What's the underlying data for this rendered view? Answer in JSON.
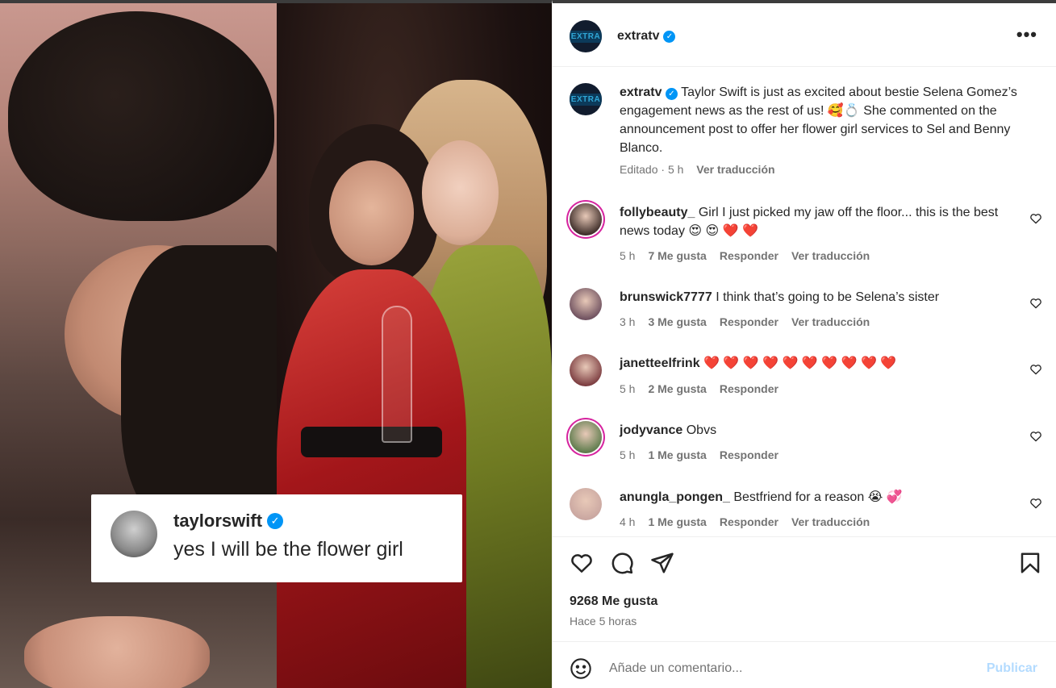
{
  "post": {
    "username": "extratv",
    "brand_mark": "EXTRA",
    "caption": "Taylor Swift is just as excited about bestie Selena Gomez’s engagement news as the rest of us! 🥰💍 She commented on the announcement post to offer her flower girl services to Sel and Benny Blanco.",
    "edited": "Editado",
    "time": "5 h",
    "translate": "Ver traducción",
    "more": "•••"
  },
  "media": {
    "overlay_user": "taylorswift",
    "overlay_text": "yes I will be the flower girl"
  },
  "comments": [
    {
      "user": "follybeauty_",
      "text": "Girl I just picked my jaw off the floor... this is the best news today 😍 😍 ❤️ ❤️",
      "time": "5 h",
      "likes": "7 Me gusta",
      "reply": "Responder",
      "translate": "Ver traducción",
      "avatar_color": "#3a2a26"
    },
    {
      "user": "brunswick7777",
      "text": "I think that’s going to be Selena’s sister",
      "time": "3 h",
      "likes": "3 Me gusta",
      "reply": "Responder",
      "translate": "Ver traducción",
      "avatar_color": "#6d4f5e"
    },
    {
      "user": "janetteelfrink",
      "text": "❤️ ❤️ ❤️ ❤️ ❤️ ❤️ ❤️ ❤️ ❤️ ❤️",
      "time": "5 h",
      "likes": "2 Me gusta",
      "reply": "Responder",
      "translate": "",
      "avatar_color": "#7a3a3e"
    },
    {
      "user": "jodyvance",
      "text": "Obvs",
      "time": "5 h",
      "likes": "1 Me gusta",
      "reply": "Responder",
      "translate": "",
      "avatar_color": "#5b7a4a"
    },
    {
      "user": "anungla_pongen_",
      "text": "Bestfriend for a reason 😭 💞",
      "time": "4 h",
      "likes": "1 Me gusta",
      "reply": "Responder",
      "translate": "Ver traducción",
      "avatar_color": "#c9a6a0"
    }
  ],
  "stats": {
    "likes": "9268 Me gusta",
    "ago": "Hace 5 horas"
  },
  "add_comment": {
    "placeholder": "Añade un comentario...",
    "publish": "Publicar"
  },
  "colors": {
    "accent": "#0095f6",
    "publish_disabled": "#b3dbff",
    "story_ring": "#d6249f",
    "muted": "#737373"
  },
  "icons": [
    "heart-icon",
    "comment-icon",
    "share-icon",
    "bookmark-icon",
    "emoji-icon",
    "more-icon",
    "verified-icon"
  ]
}
